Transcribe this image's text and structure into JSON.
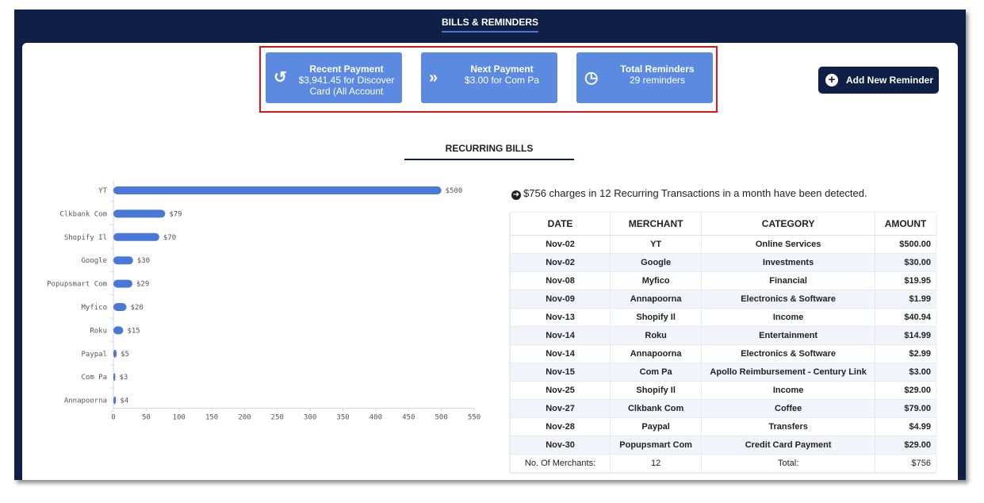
{
  "header": {
    "title": "BILLS & REMINDERS"
  },
  "cards": [
    {
      "icon": "history-icon",
      "title": "Recent Payment",
      "line1": "$3,941.45 for Discover",
      "line2": "Card (All Account"
    },
    {
      "icon": "fast-forward-icon",
      "title": "Next Payment",
      "line1": "$3.00 for Com Pa",
      "line2": ""
    },
    {
      "icon": "clock-icon",
      "title": "Total Reminders",
      "line1": "29 reminders",
      "line2": ""
    }
  ],
  "add_button": {
    "label": "Add New Reminder"
  },
  "section": {
    "title": "RECURRING BILLS"
  },
  "info_text": "$756 charges in 12 Recurring Transactions in a month have been detected.",
  "colors": {
    "navy": "#0f1f45",
    "bar": "#4a78d8",
    "card": "#5b8ae0",
    "highlight": "#e0141c"
  },
  "chart_data": {
    "type": "bar",
    "orientation": "horizontal",
    "categories": [
      "YT",
      "Clkbank Com",
      "Shopify Il",
      "Google",
      "Popupsmart Com",
      "Myfico",
      "Roku",
      "Paypal",
      "Com Pa",
      "Annapoorna"
    ],
    "values": [
      500,
      79,
      70,
      30,
      29,
      20,
      15,
      5,
      3,
      4
    ],
    "value_labels": [
      "$500",
      "$79",
      "$70",
      "$30",
      "$29",
      "$20",
      "$15",
      "$5",
      "$3",
      "$4"
    ],
    "xticks": [
      0,
      50,
      100,
      150,
      200,
      250,
      300,
      350,
      400,
      450,
      500,
      550
    ],
    "xlim": [
      0,
      550
    ]
  },
  "table": {
    "headers": [
      "DATE",
      "MERCHANT",
      "CATEGORY",
      "AMOUNT"
    ],
    "rows": [
      [
        "Nov-02",
        "YT",
        "Online Services",
        "$500.00"
      ],
      [
        "Nov-02",
        "Google",
        "Investments",
        "$30.00"
      ],
      [
        "Nov-08",
        "Myfico",
        "Financial",
        "$19.95"
      ],
      [
        "Nov-09",
        "Annapoorna",
        "Electronics & Software",
        "$1.99"
      ],
      [
        "Nov-13",
        "Shopify Il",
        "Income",
        "$40.94"
      ],
      [
        "Nov-14",
        "Roku",
        "Entertainment",
        "$14.99"
      ],
      [
        "Nov-14",
        "Annapoorna",
        "Electronics & Software",
        "$2.99"
      ],
      [
        "Nov-15",
        "Com Pa",
        "Apollo Reimbursement - Century Link",
        "$3.00"
      ],
      [
        "Nov-25",
        "Shopify Il",
        "Income",
        "$29.00"
      ],
      [
        "Nov-27",
        "Clkbank Com",
        "Coffee",
        "$79.00"
      ],
      [
        "Nov-28",
        "Paypal",
        "Transfers",
        "$4.99"
      ],
      [
        "Nov-30",
        "Popupsmart Com",
        "Credit Card Payment",
        "$29.00"
      ]
    ],
    "footer": [
      "No. Of Merchants:",
      "12",
      "Total:",
      "$756"
    ]
  }
}
